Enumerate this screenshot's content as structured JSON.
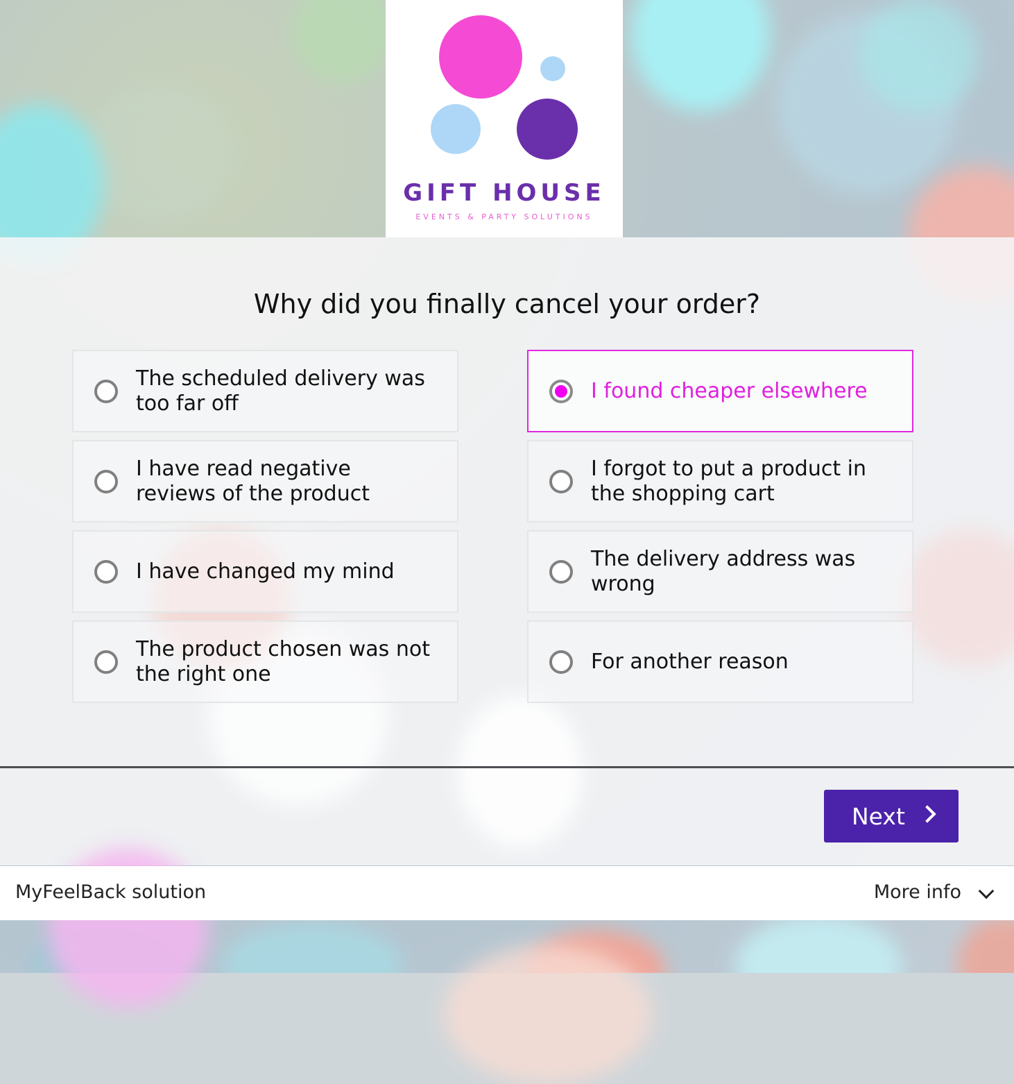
{
  "colors": {
    "accent": "#4b22aa",
    "selected": "#f000f0",
    "logo_pink": "#f44ad4",
    "logo_purple": "#6a2fab",
    "logo_light_blue": "#aed7f7"
  },
  "logo": {
    "title": "GIFT HOUSE",
    "subtitle": "EVENTS & PARTY SOLUTIONS"
  },
  "survey": {
    "question": "Why did you finally cancel your order?",
    "selected_index": 1,
    "options": [
      {
        "label": "The scheduled delivery was too far off",
        "selected": false
      },
      {
        "label": "I found cheaper elsewhere",
        "selected": true
      },
      {
        "label": "I have read negative reviews of the product",
        "selected": false
      },
      {
        "label": "I forgot to put a product in the shopping cart",
        "selected": false
      },
      {
        "label": "I have changed my mind",
        "selected": false
      },
      {
        "label": "The delivery address was wrong",
        "selected": false
      },
      {
        "label": "The product chosen was not the right one",
        "selected": false
      },
      {
        "label": "For another reason",
        "selected": false
      }
    ]
  },
  "nav": {
    "next_label": "Next",
    "next_icon": "chevron-right-icon"
  },
  "footer": {
    "brand": "MyFeelBack solution",
    "more_info": "More info",
    "more_info_icon": "chevron-down-icon"
  }
}
